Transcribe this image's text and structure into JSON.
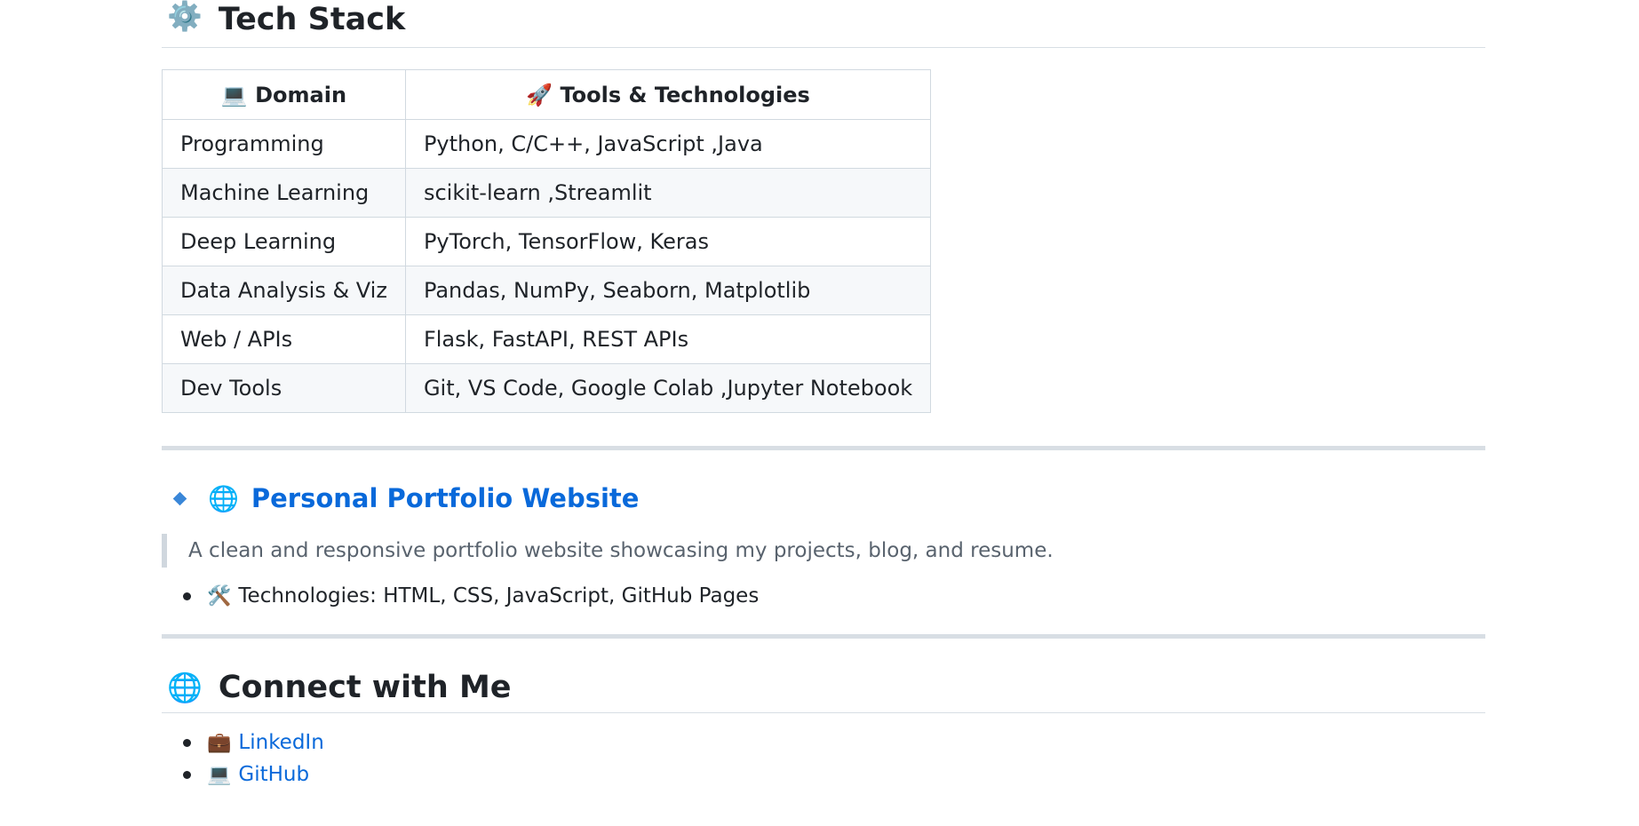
{
  "tech_stack": {
    "icon": "gear-icon",
    "title": "Tech Stack",
    "header": {
      "domain_icon": "laptop-icon",
      "domain": "Domain",
      "tools_icon": "rocket-icon",
      "tools": "Tools & Technologies"
    },
    "rows": [
      {
        "domain": "Programming",
        "tools": "Python, C/C++, JavaScript ,Java"
      },
      {
        "domain": "Machine Learning",
        "tools": "scikit-learn ,Streamlit"
      },
      {
        "domain": "Deep Learning",
        "tools": "PyTorch, TensorFlow, Keras"
      },
      {
        "domain": "Data Analysis & Viz",
        "tools": "Pandas, NumPy, Seaborn, Matplotlib"
      },
      {
        "domain": "Web / APIs",
        "tools": "Flask, FastAPI, REST APIs"
      },
      {
        "domain": "Dev Tools",
        "tools": "Git, VS Code, Google Colab ,Jupyter Notebook"
      }
    ]
  },
  "project": {
    "icon": "globe-icon",
    "title": "Personal Portfolio Website",
    "description": "A clean and responsive portfolio website showcasing my projects, blog, and resume.",
    "tech_icon": "tools-icon",
    "technologies": "Technologies: HTML, CSS, JavaScript, GitHub Pages"
  },
  "connect": {
    "icon": "globe-icon",
    "title": "Connect with Me",
    "links": [
      {
        "icon": "briefcase-icon",
        "label": "LinkedIn"
      },
      {
        "icon": "laptop-icon",
        "label": "GitHub"
      }
    ]
  },
  "colors": {
    "link": "#0969da",
    "text": "#1f2328",
    "muted": "#59636e",
    "border": "#d1d9e0"
  }
}
